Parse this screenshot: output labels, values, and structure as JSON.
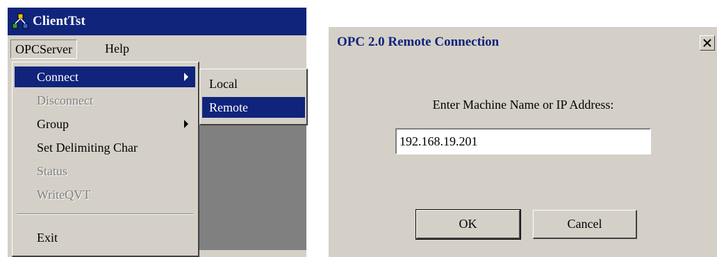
{
  "client_window": {
    "title": "ClientTst",
    "icon": "opc-network-icon",
    "menubar": [
      {
        "label": "OPCServer"
      },
      {
        "label": "Help"
      }
    ],
    "opcserver_menu": {
      "connect": "Connect",
      "disconnect": "Disconnect",
      "group": "Group",
      "set_delimiting_char": "Set Delimiting Char",
      "status": "Status",
      "write_qvt": "WriteQVT",
      "exit": "Exit"
    },
    "connect_submenu": {
      "local": "Local",
      "remote": "Remote"
    }
  },
  "dialog": {
    "title": "OPC 2.0 Remote Connection",
    "close_label": "close-icon",
    "prompt": "Enter Machine Name or IP Address:",
    "ip_value": "192.168.19.201",
    "ok_label": "OK",
    "cancel_label": "Cancel"
  },
  "colors": {
    "title_blue": "#10247b",
    "window_gray": "#d4d0c8",
    "disabled_gray": "#808080"
  }
}
